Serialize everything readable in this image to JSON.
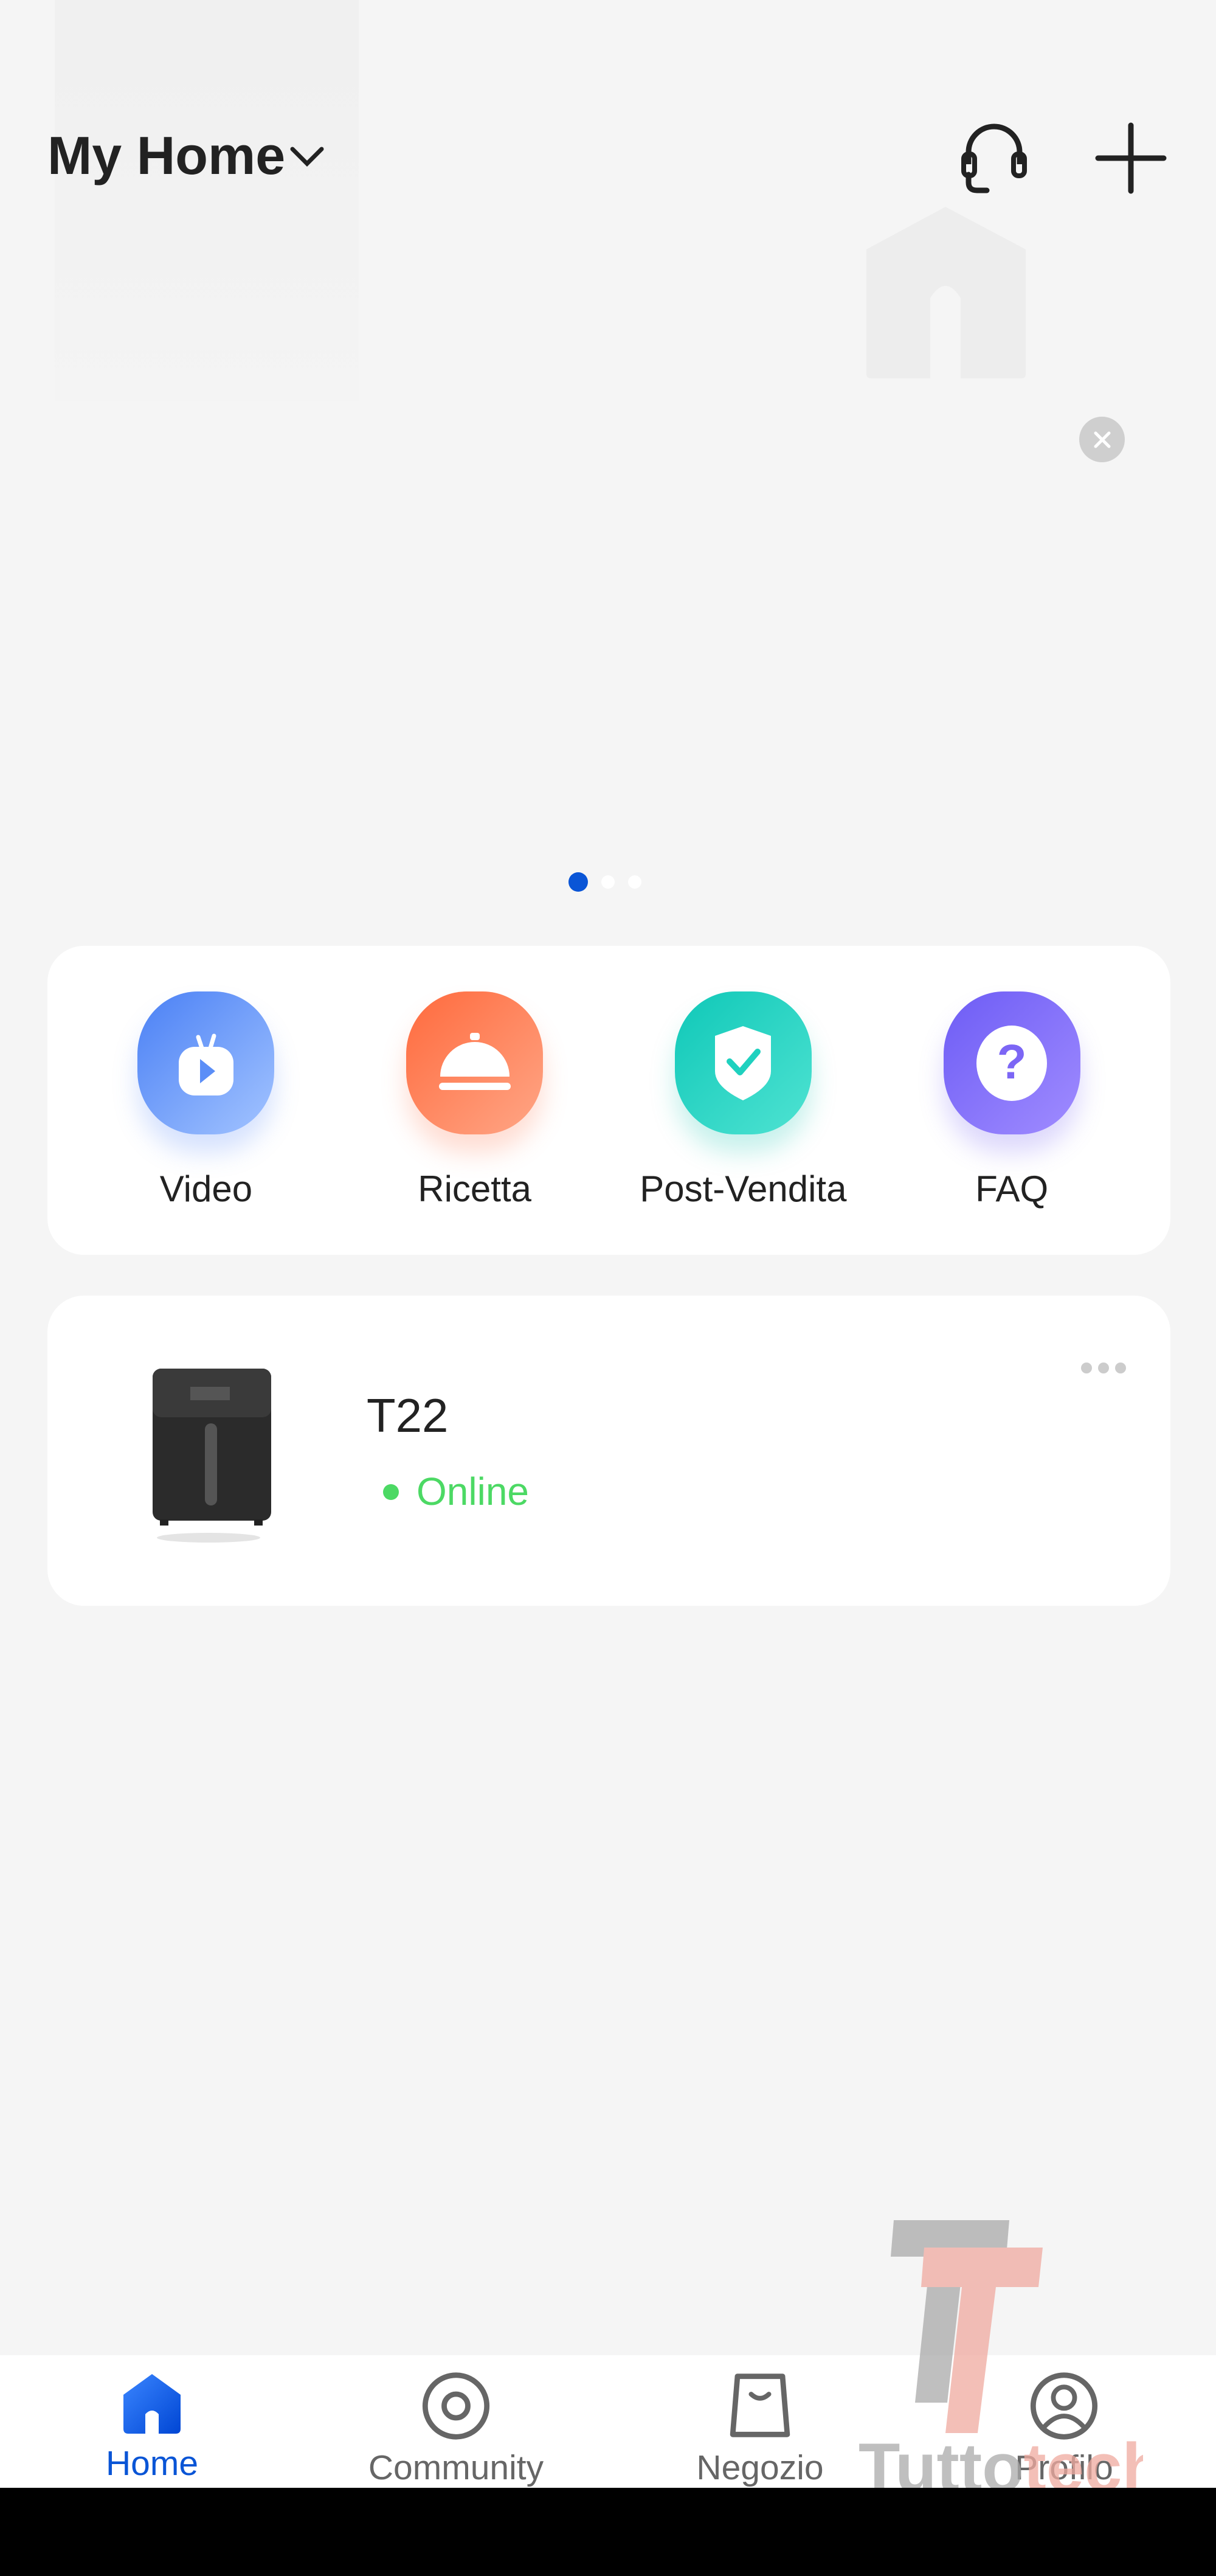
{
  "header": {
    "home_title": "My Home",
    "support_icon": "headset-icon",
    "add_icon": "plus-icon"
  },
  "banner": {
    "close_icon": "close-icon",
    "pages": 3,
    "active_page": 1,
    "accent": "#0a55d6"
  },
  "quick_actions": [
    {
      "label": "Video",
      "icon": "tv-play-icon",
      "color": "#5b8ef7"
    },
    {
      "label": "Ricetta",
      "icon": "cloche-icon",
      "color": "#ff7a52"
    },
    {
      "label": "Post-Vendita",
      "icon": "shield-check-icon",
      "color": "#1fd1bf"
    },
    {
      "label": "FAQ",
      "icon": "question-icon",
      "color": "#7c66f5"
    }
  ],
  "device": {
    "name": "T22",
    "status": "Online",
    "status_color": "#4cd964",
    "more_icon": "more-dots-icon"
  },
  "nav": [
    {
      "label": "Home",
      "icon": "home-icon",
      "active": true
    },
    {
      "label": "Community",
      "icon": "community-icon",
      "active": false
    },
    {
      "label": "Negozio",
      "icon": "shop-bag-icon",
      "active": false
    },
    {
      "label": "Profilo",
      "icon": "profile-icon",
      "active": false
    }
  ],
  "watermark": {
    "text": "Tuttotech"
  }
}
